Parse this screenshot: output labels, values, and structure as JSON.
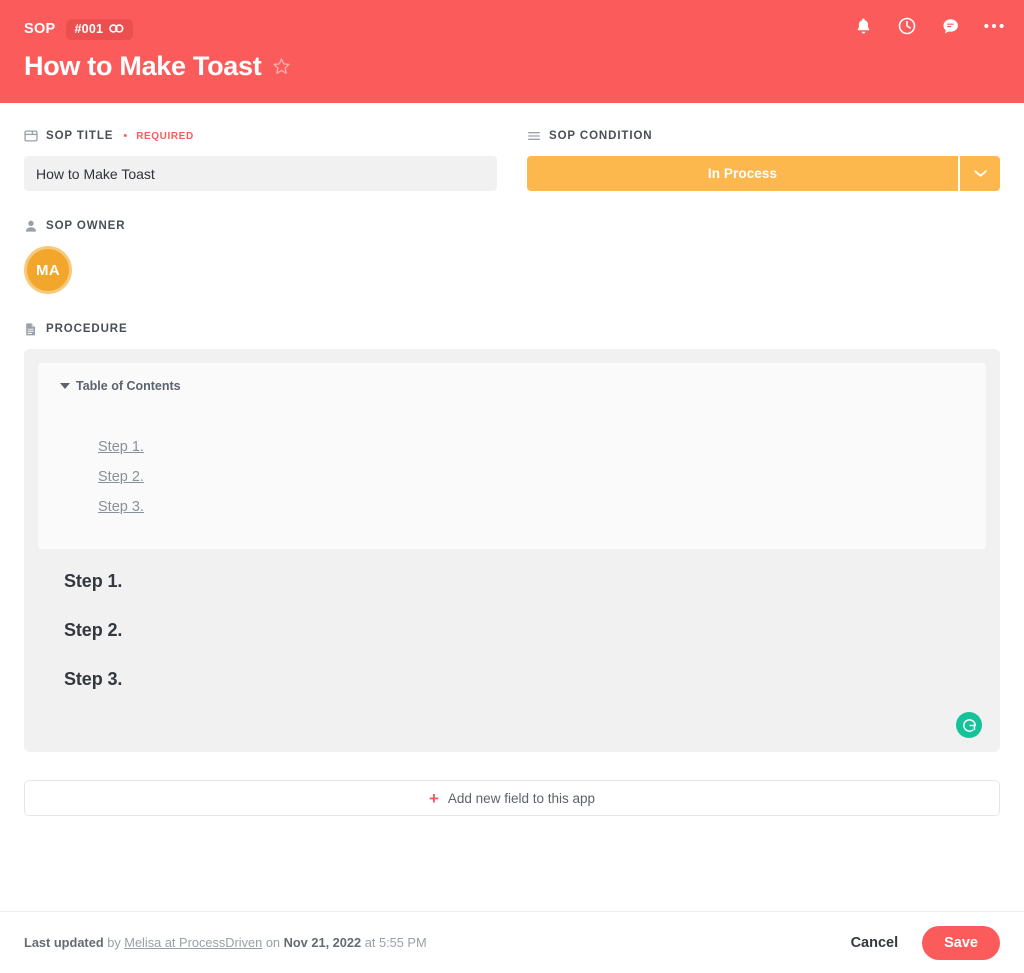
{
  "header": {
    "kicker": "SOP",
    "id_badge": "#001",
    "title": "How to Make Toast",
    "icons": {
      "link": "link-icon",
      "star": "star-icon",
      "bell": "bell-icon",
      "clock": "clock-icon",
      "comment": "comment-icon",
      "more": "ellipsis-icon"
    },
    "accent_color": "#fb5b5b"
  },
  "fields": {
    "title_field": {
      "label": "SOP TITLE",
      "required_text": "REQUIRED",
      "value": "How to Make Toast",
      "placeholder": "How to Make Toast",
      "icon": "text-field-icon"
    },
    "condition_field": {
      "label": "SOP CONDITION",
      "value": "In Process",
      "icon": "list-icon",
      "color": "#fcb84d",
      "caret": "chevron-down-icon"
    },
    "owner_field": {
      "label": "SOP OWNER",
      "icon": "person-icon",
      "avatar_initials": "MA",
      "avatar_color": "#f2a62c"
    },
    "procedure_field": {
      "label": "PROCEDURE",
      "icon": "document-icon"
    }
  },
  "procedure": {
    "toc_title": "Table of Contents",
    "toc_links": [
      "",
      "Step 1.",
      "Step 2.",
      "Step 3."
    ],
    "steps": [
      "Step 1.",
      "Step 2.",
      "Step 3."
    ],
    "grammarly_icon": "grammarly-icon"
  },
  "add_field": {
    "plus": "+",
    "label": "Add new field to this app"
  },
  "footer": {
    "updated_prefix": "Last updated",
    "by_word": "by",
    "author": "Melisa at ProcessDriven",
    "on_word": "on",
    "date": "Nov 21, 2022",
    "at_word": "at",
    "time": "5:55 PM",
    "cancel_label": "Cancel",
    "save_label": "Save"
  }
}
